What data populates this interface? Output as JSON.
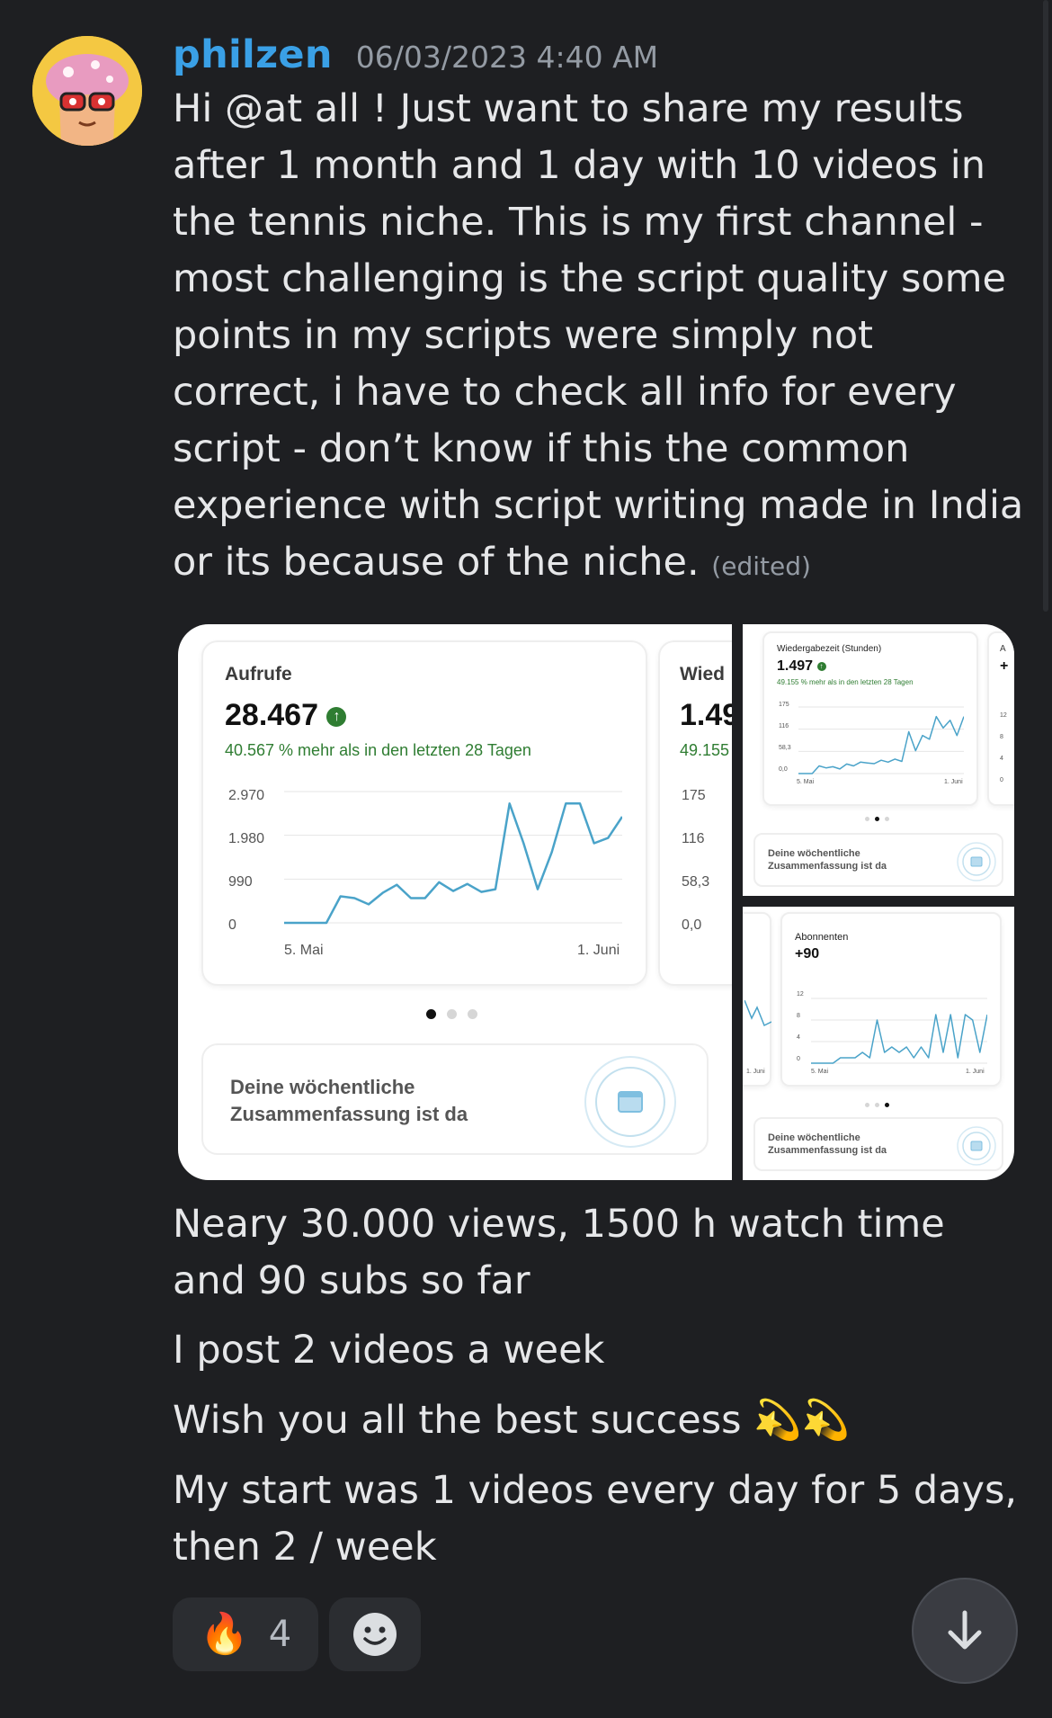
{
  "message": {
    "username": "philzen",
    "timestamp": "06/03/2023 4:40 AM",
    "text": "Hi @at all ! Just want to share my results after 1 month and 1 day with 10 videos in the tennis niche. This is my first channel - most challenging is the script quality some points in my scripts were simply not correct, i have to check all info for every script - don’t know if this the common experience with script writing made in India or its because of the niche.",
    "edited_label": "(edited)",
    "followups": [
      "Neary 30.000 views, 1500 h watch time and 90 subs so far",
      "I post 2 videos a week",
      "Wish you all the best success 💫💫",
      "My start was 1 videos every day for 5 days, then 2 / week"
    ]
  },
  "attachments": {
    "views_card": {
      "label": "Aufrufe",
      "value": "28.467",
      "delta": "40.567 % mehr als in den letzten 28 Tagen",
      "y_ticks": [
        "2.970",
        "1.980",
        "990",
        "0"
      ],
      "x_start": "5. Mai",
      "x_end": "1. Juni"
    },
    "watchtime_peek": {
      "label": "Wied",
      "value": "1.49",
      "delta": "49.155",
      "y_ticks": [
        "175",
        "116",
        "58,3",
        "0,0"
      ]
    },
    "watchtime_card": {
      "label": "Wiedergabezeit (Stunden)",
      "value": "1.497",
      "delta": "49.155 % mehr als in den letzten 28 Tagen",
      "y_ticks": [
        "175",
        "116",
        "58,3",
        "0,0"
      ],
      "x_start": "5. Mai",
      "x_end": "1. Juni",
      "peek_label": "A",
      "peek_value": "+",
      "peek_ticks": [
        "12",
        "8",
        "4",
        "0"
      ]
    },
    "subs_card": {
      "label": "Abonnenten",
      "value": "+90",
      "y_ticks": [
        "12",
        "8",
        "4",
        "0"
      ],
      "x_start": "5. Mai",
      "x_end": "1. Juni",
      "peek_x_label": "1. Juni"
    },
    "summary_text_line1": "Deine wöchentliche",
    "summary_text_line2": "Zusammenfassung ist da",
    "chart_color": "#4aa3c9"
  },
  "chart_data": [
    {
      "type": "line",
      "title": "Aufrufe",
      "x": [
        "5. Mai",
        "1. Juni"
      ],
      "ylim": [
        0,
        2970
      ],
      "values": [
        0,
        0,
        0,
        0,
        600,
        560,
        420,
        680,
        860,
        560,
        560,
        920,
        720,
        880,
        700,
        760,
        2700,
        1800,
        760,
        1600,
        2700,
        2700,
        1800,
        1920,
        2400
      ]
    },
    {
      "type": "line",
      "title": "Wiedergabezeit (Stunden)",
      "x": [
        "5. Mai",
        "1. Juni"
      ],
      "ylim": [
        0,
        175
      ],
      "values": [
        0,
        0,
        0,
        20,
        15,
        18,
        12,
        25,
        20,
        30,
        28,
        26,
        35,
        30,
        38,
        32,
        110,
        60,
        100,
        90,
        150,
        120,
        140,
        100,
        150
      ]
    },
    {
      "type": "line",
      "title": "Abonnenten",
      "x": [
        "5. Mai",
        "1. Juni"
      ],
      "ylim": [
        0,
        12
      ],
      "values": [
        0,
        0,
        0,
        0,
        1,
        1,
        1,
        2,
        1,
        8,
        2,
        3,
        2,
        3,
        1,
        3,
        1,
        9,
        2,
        9,
        1,
        9,
        8,
        2,
        9
      ]
    }
  ],
  "reactions": [
    {
      "emoji": "🔥",
      "count": "4"
    }
  ],
  "colors": {
    "background": "#1e1f22",
    "username": "#3aa0e6",
    "reaction_bg": "#2b2d31"
  }
}
